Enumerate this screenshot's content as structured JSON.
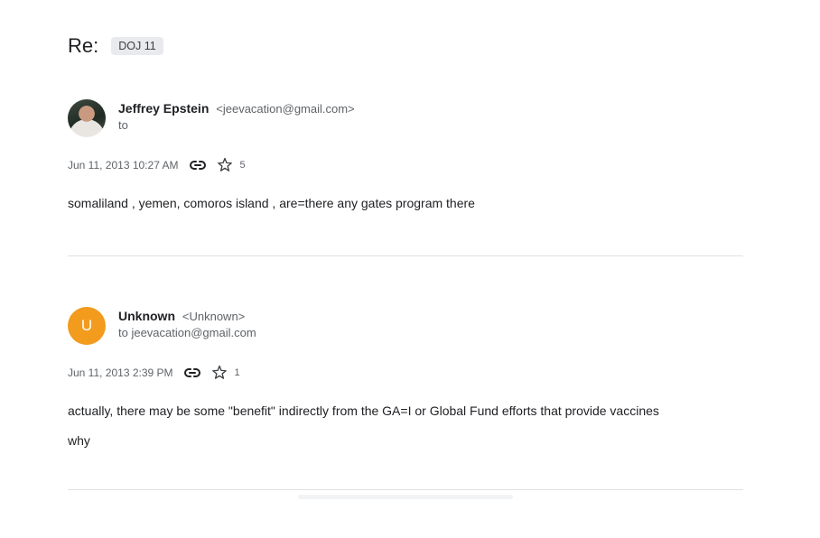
{
  "thread": {
    "subject": "Re:",
    "label": "DOJ 11"
  },
  "messages": [
    {
      "avatar": {
        "type": "photo",
        "icon": "profile-photo"
      },
      "sender_name": "Jeffrey Epstein",
      "sender_email": "<jeevacation@gmail.com>",
      "to_line": "to",
      "date": "Jun 11, 2013 10:27 AM",
      "star_count": "5",
      "body": [
        "somaliland , yemen, comoros island , are=there any gates program there"
      ]
    },
    {
      "avatar": {
        "type": "letter",
        "letter": "U",
        "color": "#f29b1d"
      },
      "sender_name": "Unknown",
      "sender_email": "<Unknown>",
      "to_line": "to jeevacation@gmail.com",
      "date": "Jun 11, 2013 2:39 PM",
      "star_count": "1",
      "body": [
        "actually, there may be some \"benefit\" indirectly from the GA=I or Global Fund efforts that provide vaccines",
        "why"
      ]
    }
  ],
  "icons": {
    "link": "link-icon",
    "star": "star-outline-icon"
  },
  "colors": {
    "label_bg": "#e8eaed",
    "avatar_unknown": "#f29b1d",
    "divider": "#e0e0e0",
    "secondary_text": "#5f6368"
  }
}
